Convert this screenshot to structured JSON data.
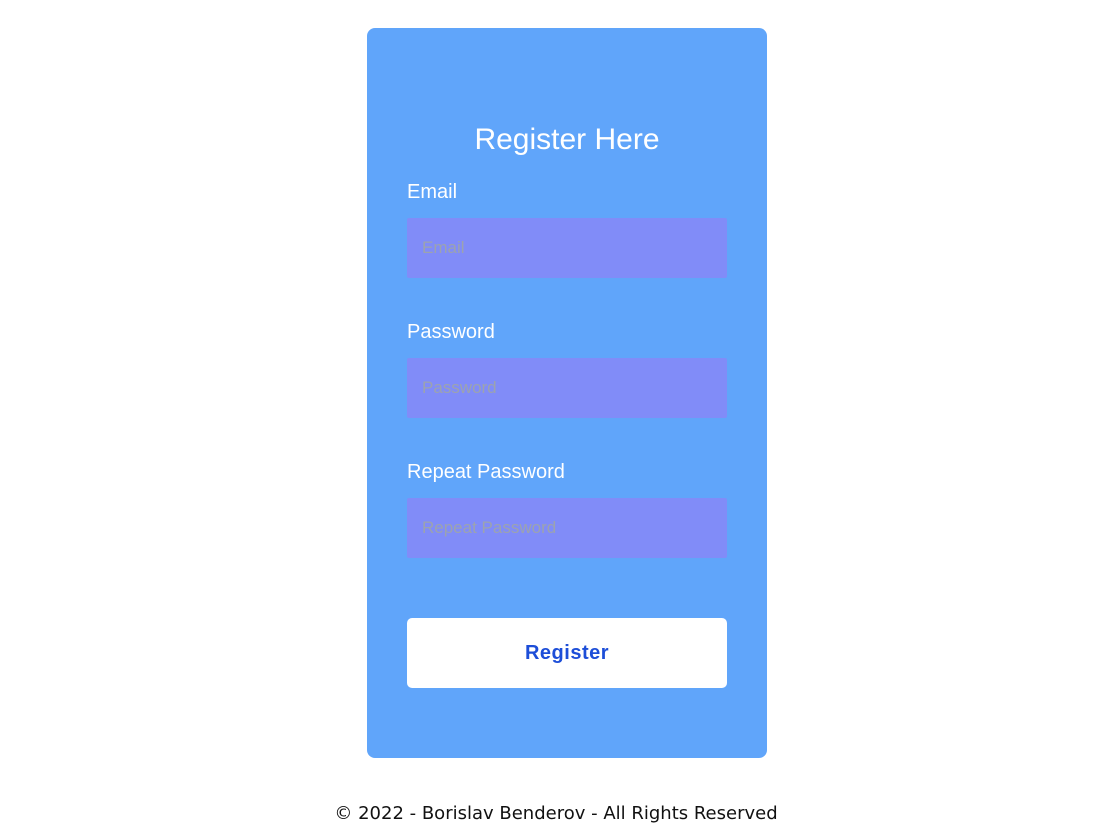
{
  "form": {
    "title": "Register Here",
    "fields": [
      {
        "label": "Email",
        "placeholder": "Email",
        "value": ""
      },
      {
        "label": "Password",
        "placeholder": "Password",
        "value": ""
      },
      {
        "label": "Repeat Password",
        "placeholder": "Repeat Password",
        "value": ""
      }
    ],
    "submit_label": "Register"
  },
  "footer": {
    "text": "© 2022 - Borislav Benderov - All Rights Reserved"
  },
  "colors": {
    "card_background": "#60a5fa",
    "input_background": "#818cf8",
    "button_text": "#1d4ed8",
    "page_background": "#ffffff"
  }
}
